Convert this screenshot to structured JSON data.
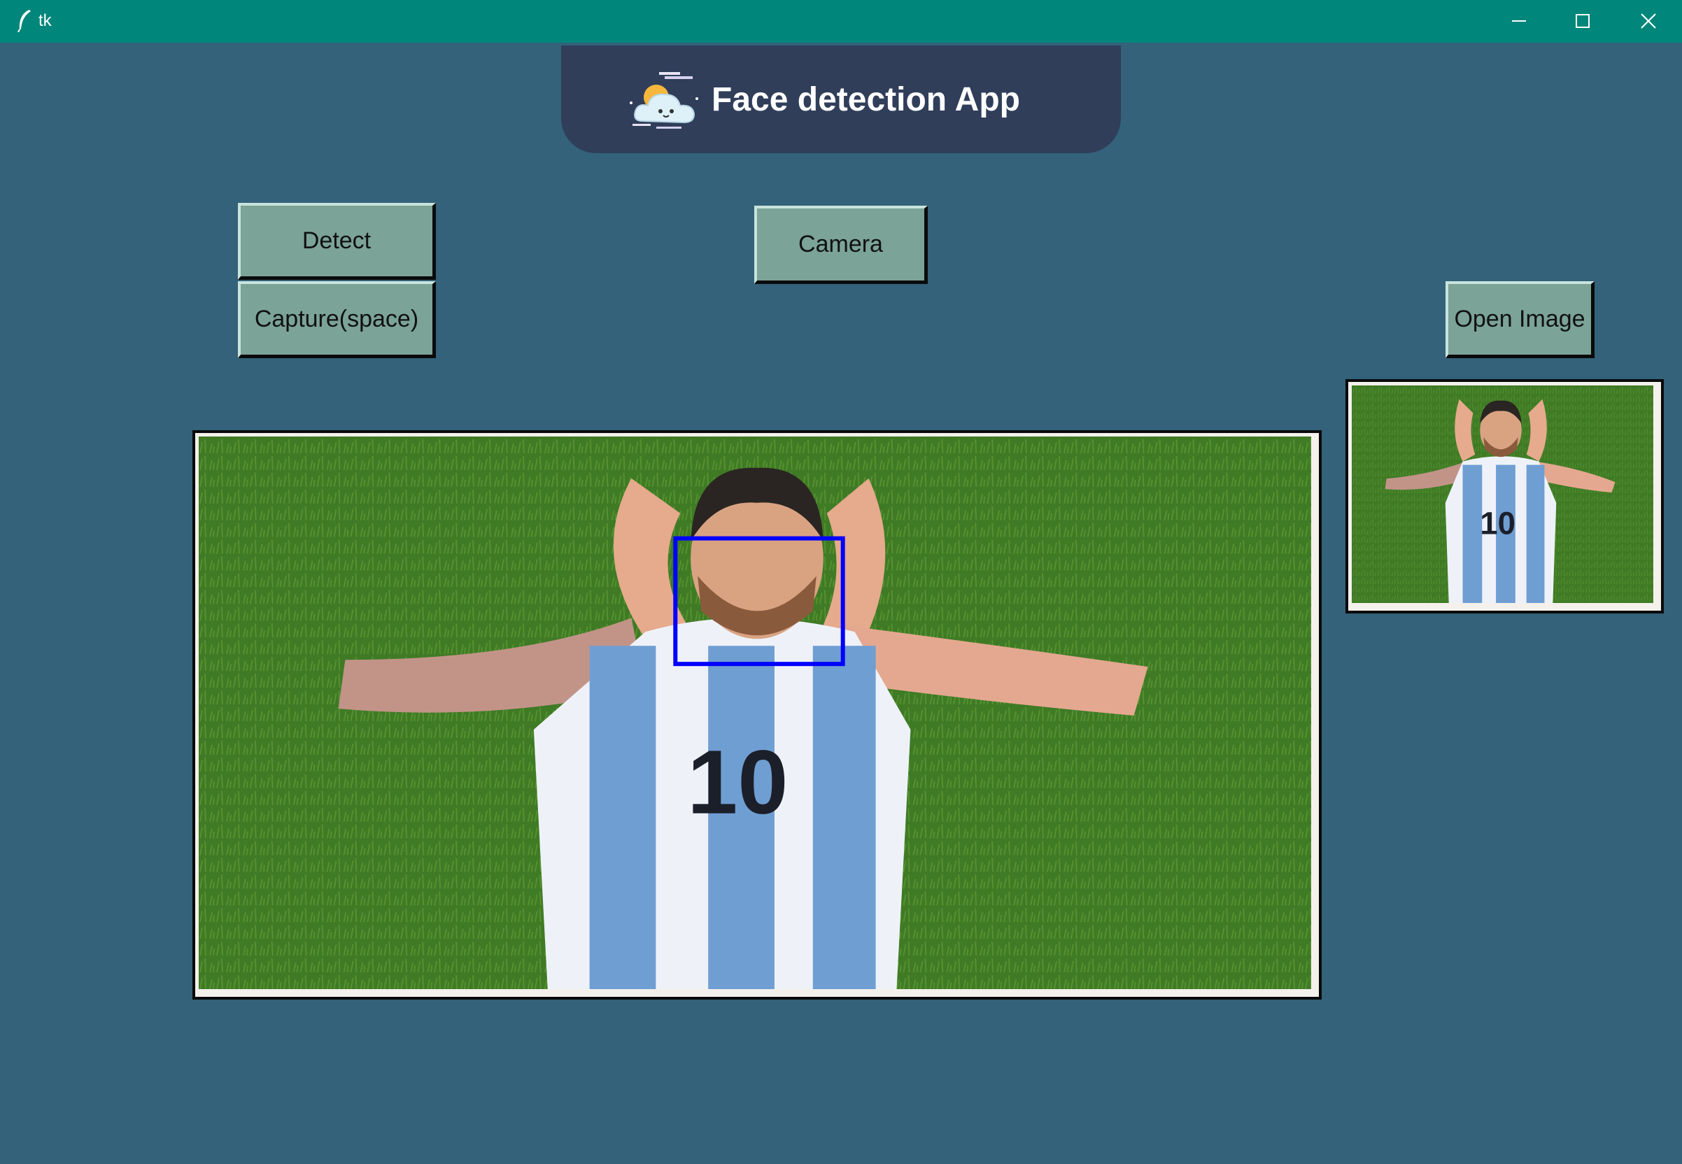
{
  "window": {
    "title": "tk",
    "controls": [
      "minimize-icon",
      "maximize-icon",
      "close-icon"
    ],
    "titlebar_color": "#00867a"
  },
  "header": {
    "title": "Face detection App",
    "icon": "cloud-weather-icon",
    "background": "#303e5a"
  },
  "buttons": {
    "detect": "Detect",
    "capture": "Capture(space)",
    "camera": "Camera",
    "open_image": "Open Image"
  },
  "main_image": {
    "content": "soccer-player-photo",
    "detections": 1,
    "box_color": "#0000ff"
  },
  "thumbnail": {
    "content": "soccer-player-photo"
  },
  "colors": {
    "background": "#33627a",
    "button_face": "#7ba398",
    "image_frame": "#f4f1ec"
  }
}
